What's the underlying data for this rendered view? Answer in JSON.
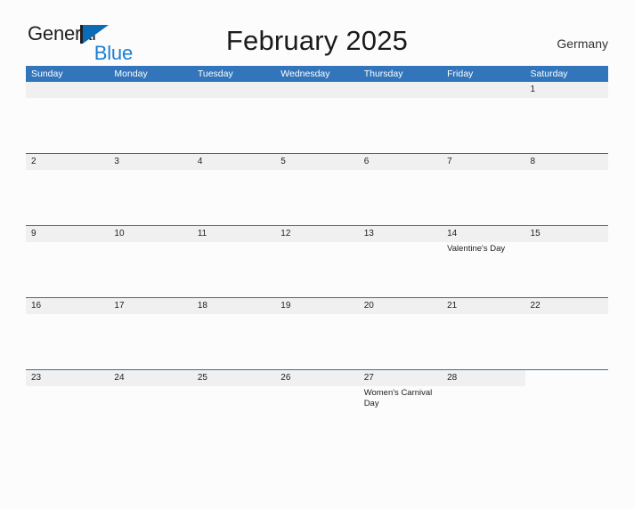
{
  "brand": {
    "word1": "General",
    "word2": "Blue",
    "flag_icon": "blue-flag-triangle-icon",
    "colors": {
      "word1": "#231f20",
      "word2": "#1a7fd4",
      "flag": "#0b6cb5"
    }
  },
  "header": {
    "title": "February 2025",
    "country": "Germany"
  },
  "calendar": {
    "colors": {
      "header_blue": "#3275bb",
      "row_border_blue": "#2f6fae",
      "day_band_gray": "#f0f0f0",
      "text": "#222222"
    },
    "weekdays": [
      "Sunday",
      "Monday",
      "Tuesday",
      "Wednesday",
      "Thursday",
      "Friday",
      "Saturday"
    ],
    "weeks": [
      [
        {
          "day": "",
          "events": []
        },
        {
          "day": "",
          "events": []
        },
        {
          "day": "",
          "events": []
        },
        {
          "day": "",
          "events": []
        },
        {
          "day": "",
          "events": []
        },
        {
          "day": "",
          "events": []
        },
        {
          "day": "1",
          "events": []
        }
      ],
      [
        {
          "day": "2",
          "events": []
        },
        {
          "day": "3",
          "events": []
        },
        {
          "day": "4",
          "events": []
        },
        {
          "day": "5",
          "events": []
        },
        {
          "day": "6",
          "events": []
        },
        {
          "day": "7",
          "events": []
        },
        {
          "day": "8",
          "events": []
        }
      ],
      [
        {
          "day": "9",
          "events": []
        },
        {
          "day": "10",
          "events": []
        },
        {
          "day": "11",
          "events": []
        },
        {
          "day": "12",
          "events": []
        },
        {
          "day": "13",
          "events": []
        },
        {
          "day": "14",
          "events": [
            "Valentine's Day"
          ]
        },
        {
          "day": "15",
          "events": []
        }
      ],
      [
        {
          "day": "16",
          "events": []
        },
        {
          "day": "17",
          "events": []
        },
        {
          "day": "18",
          "events": []
        },
        {
          "day": "19",
          "events": []
        },
        {
          "day": "20",
          "events": []
        },
        {
          "day": "21",
          "events": []
        },
        {
          "day": "22",
          "events": []
        }
      ],
      [
        {
          "day": "23",
          "events": []
        },
        {
          "day": "24",
          "events": []
        },
        {
          "day": "25",
          "events": []
        },
        {
          "day": "26",
          "events": []
        },
        {
          "day": "27",
          "events": [
            "Women's Carnival Day"
          ]
        },
        {
          "day": "28",
          "events": []
        },
        {
          "day": "",
          "events": []
        }
      ]
    ]
  }
}
